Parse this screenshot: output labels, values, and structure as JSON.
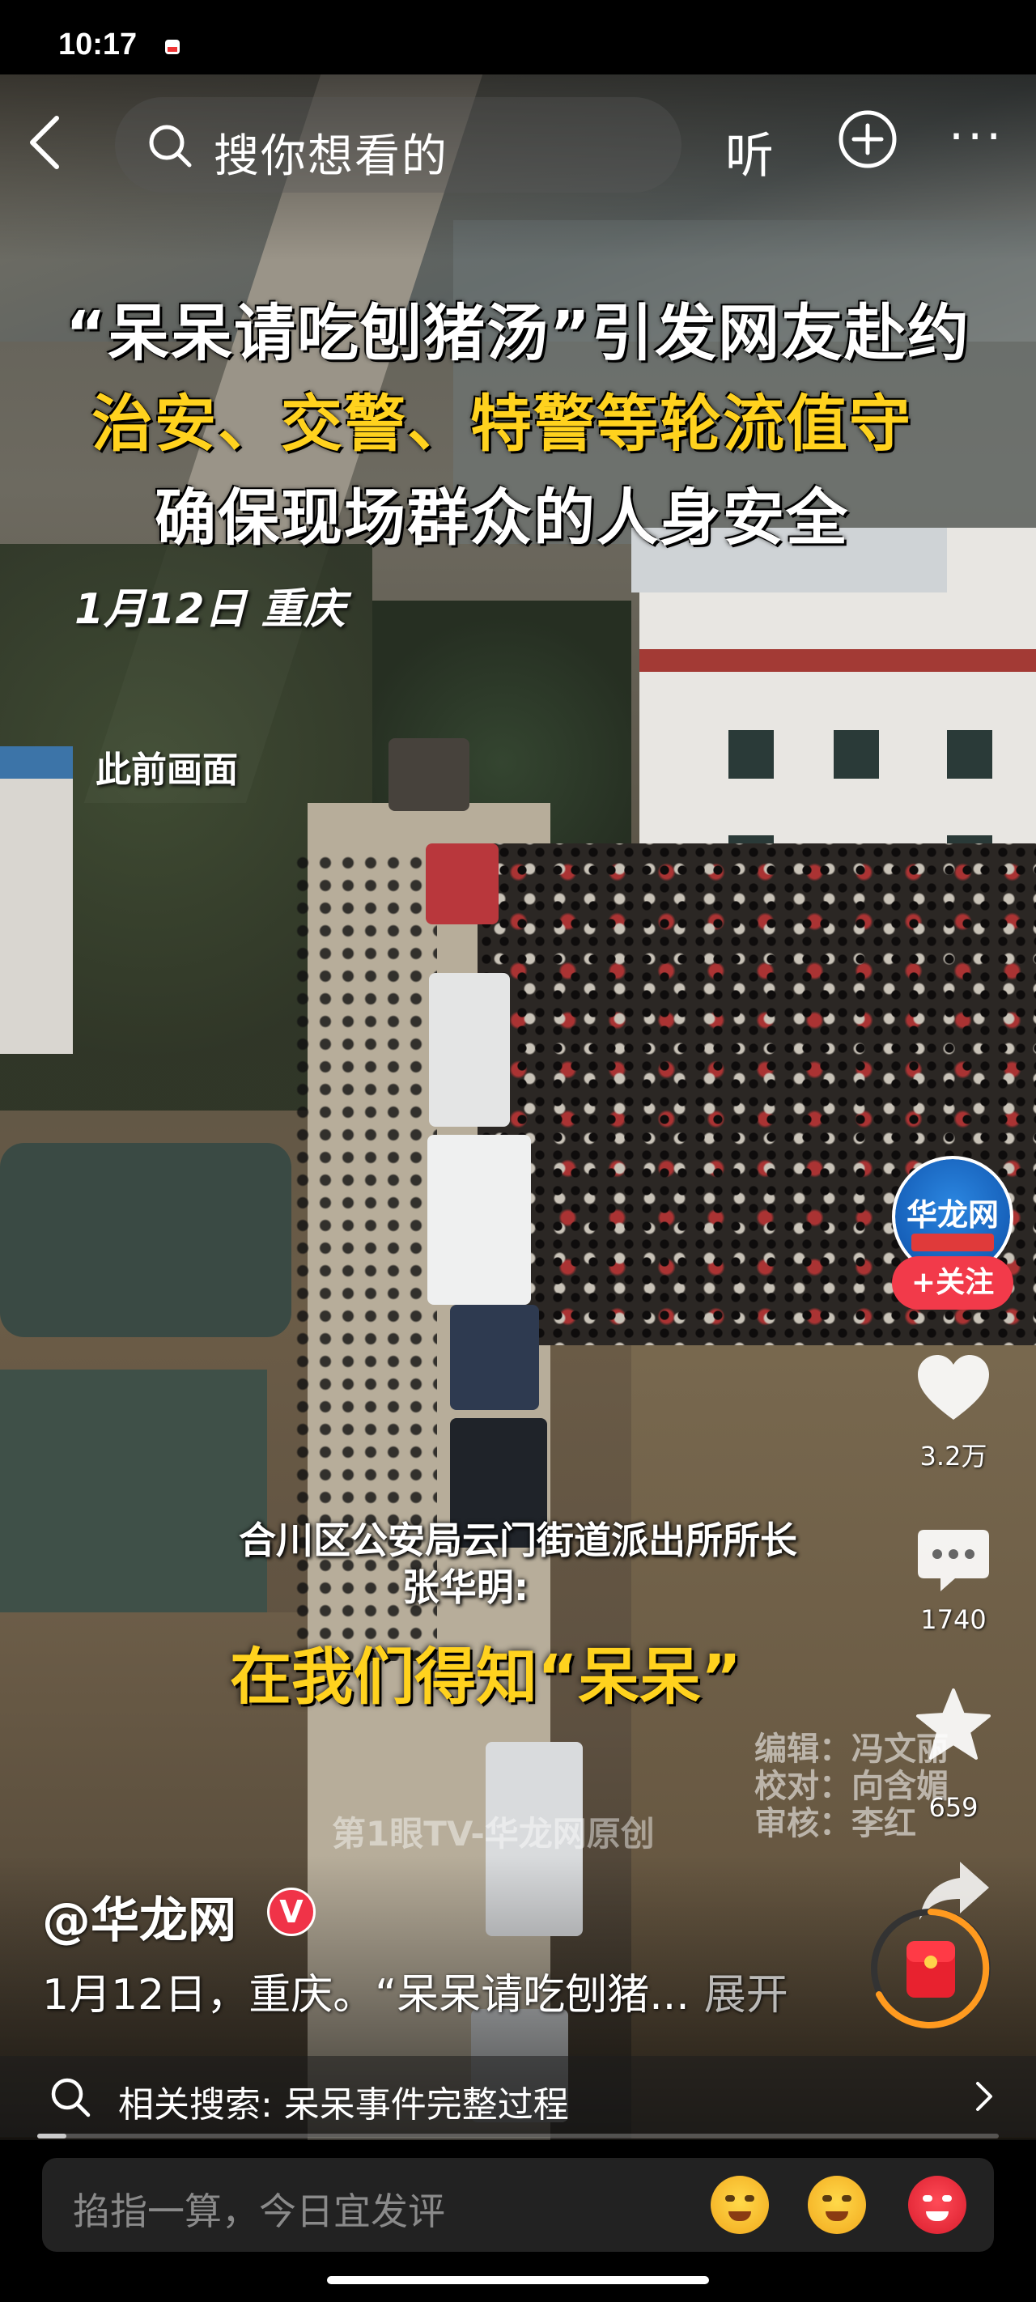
{
  "status_bar": {
    "time": "10:17"
  },
  "top_bar": {
    "search_placeholder": "搜你想看的",
    "listen_label": "听",
    "more_label": "···"
  },
  "video": {
    "headline_line1": "“呆呆请吃刨猪汤”引发网友赴约",
    "headline_line2": "治安、交警、特警等轮流值守",
    "headline_line3": "确保现场群众的人身安全",
    "date_location": "1月12日 重庆",
    "earlier_footage": "此前画面",
    "speaker_line1": "合川区公安局云门街道派出所所长",
    "speaker_line2": "张华明:",
    "quote": "在我们得知“呆呆”",
    "credits": [
      "编辑：冯文丽",
      "校对：向含媚",
      "审核：李红"
    ],
    "watermark": "第1眼TV-华龙网原创",
    "progress_fraction": 0.03
  },
  "right_rail": {
    "avatar_text": "华龙网",
    "follow_label": "+关注",
    "like_count": "3.2万",
    "comment_count": "1740",
    "favorite_count": "659"
  },
  "post": {
    "author": "@华龙网",
    "verified_mark": "V",
    "description": "1月12日，重庆。“呆呆请吃刨猪...",
    "expand_label": "展开"
  },
  "related_search": {
    "text": "相关搜索: 呆呆事件完整过程"
  },
  "comment_bar": {
    "placeholder": "掐指一算，今日宜发评"
  },
  "colors": {
    "accent_red": "#f23a4a",
    "caption_yellow": "#ffd21e",
    "brand_blue": "#1565c0"
  }
}
